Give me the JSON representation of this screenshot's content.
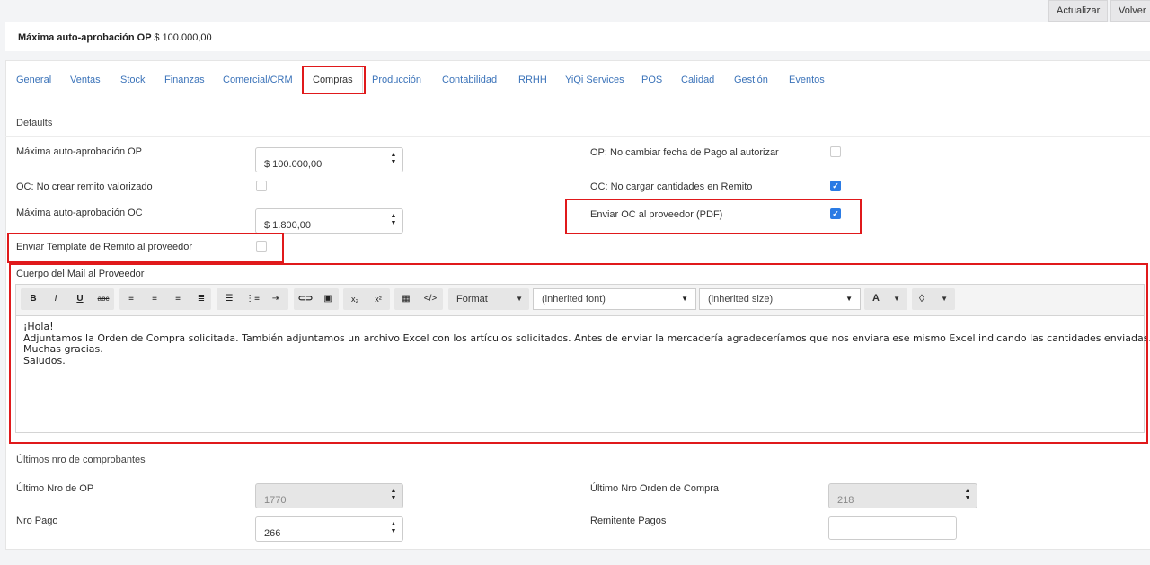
{
  "top_buttons": {
    "update": "Actualizar",
    "back": "Volver"
  },
  "header": {
    "title": "Máxima auto-aprobación OP",
    "value": "$ 100.000,00"
  },
  "tabs": [
    {
      "label": "General"
    },
    {
      "label": "Ventas"
    },
    {
      "label": "Stock"
    },
    {
      "label": "Finanzas"
    },
    {
      "label": "Comercial/CRM"
    },
    {
      "label": "Compras"
    },
    {
      "label": "Producción"
    },
    {
      "label": "Contabilidad"
    },
    {
      "label": "RRHH"
    },
    {
      "label": "YiQi Services"
    },
    {
      "label": "POS"
    },
    {
      "label": "Calidad"
    },
    {
      "label": "Gestión"
    },
    {
      "label": "Eventos"
    }
  ],
  "active_tab": "Compras",
  "defaults": {
    "section_title": "Defaults",
    "max_op_label": "Máxima auto-aprobación OP",
    "max_op_value": "$ 100.000,00",
    "oc_no_remito_label": "OC: No crear remito valorizado",
    "oc_no_remito_checked": false,
    "max_oc_label": "Máxima auto-aprobación OC",
    "max_oc_value": "$ 1.800,00",
    "send_template_label": "Enviar Template de Remito al proveedor",
    "send_template_checked": false,
    "op_no_change_date_label": "OP: No cambiar fecha de Pago al autorizar",
    "op_no_change_date_checked": false,
    "oc_no_qty_label": "OC: No cargar cantidades en Remito",
    "oc_no_qty_checked": true,
    "send_oc_pdf_label": "Enviar OC al proveedor (PDF)",
    "send_oc_pdf_checked": true
  },
  "mail": {
    "label": "Cuerpo del Mail al Proveedor",
    "toolbar": {
      "format": "Format",
      "font": "(inherited font)",
      "size": "(inherited size)",
      "bold": "B",
      "italic": "I",
      "underline": "U",
      "strike": "abc",
      "text_color": "A"
    },
    "body": [
      "¡Hola!",
      "Adjuntamos la Orden de Compra solicitada. También adjuntamos un archivo Excel con los artículos solicitados. Antes de enviar la mercadería agradeceríamos que nos enviara ese mismo Excel indicando las cantidades enviadas.",
      "Muchas gracias.",
      "Saludos."
    ]
  },
  "last_numbers": {
    "section_title": "Últimos nro de comprobantes",
    "last_op_label": "Último Nro de OP",
    "last_op_value": "1770",
    "last_oc_label": "Último Nro Orden de Compra",
    "last_oc_value": "218",
    "nro_pago_label": "Nro Pago",
    "nro_pago_value": "266",
    "remitente_label": "Remitente Pagos",
    "remitente_value": ""
  },
  "colors": {
    "accent": "#2b7be4",
    "link": "#3b73b9",
    "highlight": "#e0191b"
  }
}
